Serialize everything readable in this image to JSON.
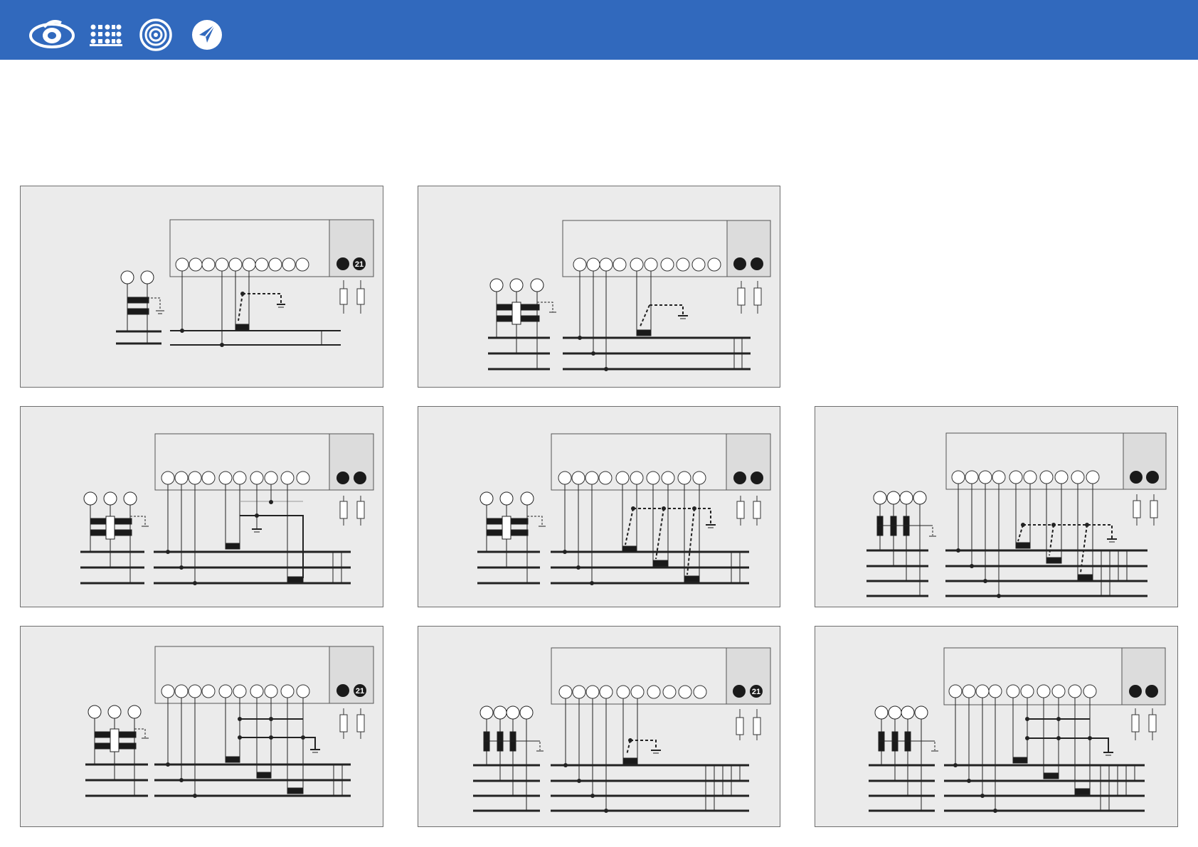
{
  "header": {
    "nav_icons": [
      "eye-icon",
      "grid-icon",
      "spiral-target-icon",
      "paper-plane-icon"
    ],
    "color": "#3169bd"
  },
  "panels": [
    {
      "id": "a",
      "row": 1,
      "col": 1,
      "terminals": 10,
      "badge": "21",
      "phases": 1,
      "ct": 1,
      "vt": "single",
      "vt_inputs": 2
    },
    {
      "id": "b",
      "row": 1,
      "col": 2,
      "terminals": 10,
      "badge": "",
      "phases": 3,
      "ct": 1,
      "vt": "double",
      "vt_inputs": 3
    },
    {
      "id": "c",
      "row": 2,
      "col": 1,
      "terminals": 10,
      "badge": "",
      "phases": 3,
      "ct": 2,
      "vt": "double",
      "vt_inputs": 3
    },
    {
      "id": "d",
      "row": 2,
      "col": 2,
      "terminals": 10,
      "badge": "",
      "phases": 3,
      "ct": 3,
      "vt": "double",
      "vt_inputs": 3
    },
    {
      "id": "e",
      "row": 2,
      "col": 3,
      "terminals": 10,
      "badge": "",
      "phases": 4,
      "ct": 3,
      "vt": "star",
      "vt_inputs": 4
    },
    {
      "id": "f",
      "row": 3,
      "col": 1,
      "terminals": 10,
      "badge": "21",
      "phases": 3,
      "ct": 3,
      "vt": "double",
      "vt_inputs": 3
    },
    {
      "id": "g",
      "row": 3,
      "col": 2,
      "terminals": 10,
      "badge": "21",
      "phases": 4,
      "ct": 1,
      "vt": "star",
      "vt_inputs": 4
    },
    {
      "id": "h",
      "row": 3,
      "col": 3,
      "terminals": 10,
      "badge": "",
      "phases": 4,
      "ct": 3,
      "vt": "star",
      "vt_inputs": 4
    }
  ]
}
